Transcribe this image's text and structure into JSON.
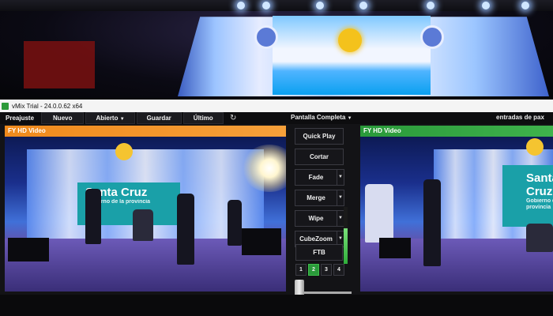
{
  "window": {
    "title": "vMix Trial - 24.0.0.62 x64"
  },
  "menu": [
    {
      "label": "Preajuste"
    },
    {
      "label": "Nuevo"
    },
    {
      "label": "Abierto"
    },
    {
      "label": "Guardar"
    },
    {
      "label": "Último"
    }
  ],
  "toolbar": {
    "fullscreen_label": "Pantalla Completa",
    "inputs_label": "entradas de pax"
  },
  "preview": {
    "label": "FY HD Video"
  },
  "output": {
    "label": "FY HD Video"
  },
  "banner": {
    "title": "Santa Cruz",
    "subtitle": "Gobierno de la provincia"
  },
  "transitions": {
    "quick_play": "Quick Play",
    "cut": "Cortar",
    "fade": "Fade",
    "merge": "Merge",
    "wipe": "Wipe",
    "cube_zoom": "CubeZoom",
    "ftb": "FTB",
    "numbers": [
      "1",
      "2",
      "3",
      "4"
    ],
    "active_number": "2"
  },
  "audio_meter_level": 0.62,
  "colors": {
    "preview_accent": "#f08a1c",
    "output_accent": "#2a9a3a"
  }
}
